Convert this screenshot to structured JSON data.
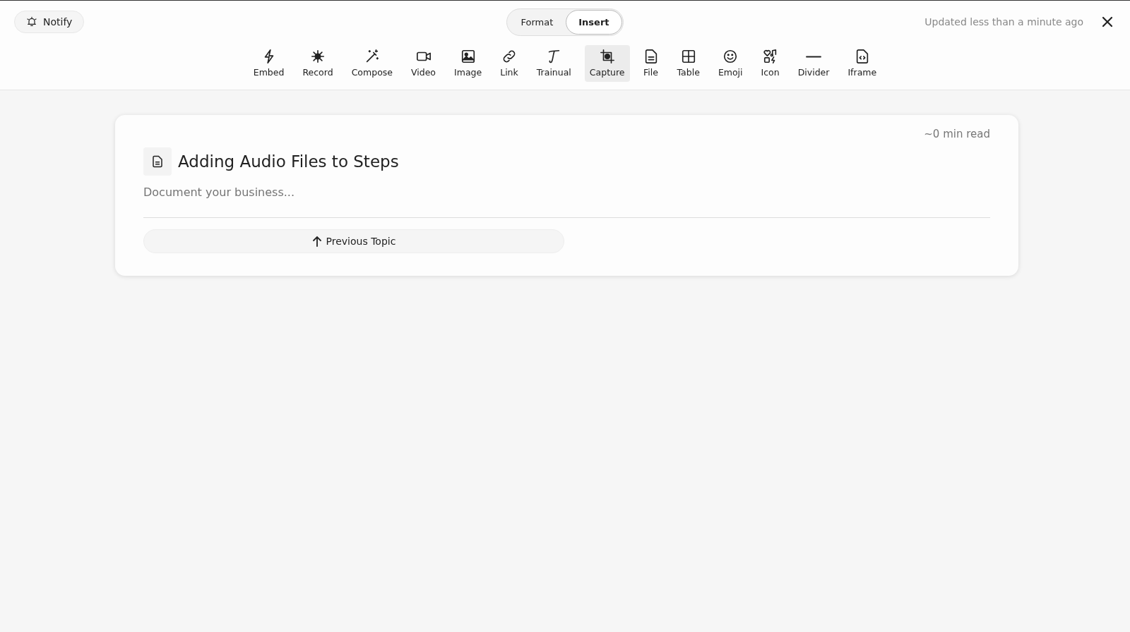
{
  "notify_button": {
    "label": "Notify"
  },
  "mode_switch": [
    {
      "label": "Format",
      "selected": false
    },
    {
      "label": "Insert",
      "selected": true
    }
  ],
  "status": "Updated less than a minute ago",
  "toolbar": [
    {
      "kind": "embed",
      "label": "Embed",
      "selected": false
    },
    {
      "kind": "record",
      "label": "Record",
      "selected": false
    },
    {
      "kind": "compose",
      "label": "Compose",
      "selected": false
    },
    {
      "kind": "video",
      "label": "Video",
      "selected": false
    },
    {
      "kind": "image",
      "label": "Image",
      "selected": false
    },
    {
      "kind": "link",
      "label": "Link",
      "selected": false
    },
    {
      "kind": "trainual",
      "label": "Trainual",
      "selected": false
    },
    {
      "kind": "capture",
      "label": "Capture",
      "selected": true
    },
    {
      "kind": "file",
      "label": "File",
      "selected": false
    },
    {
      "kind": "table",
      "label": "Table",
      "selected": false
    },
    {
      "kind": "emoji",
      "label": "Emoji",
      "selected": false
    },
    {
      "kind": "icon",
      "label": "Icon",
      "selected": false
    },
    {
      "kind": "divider",
      "label": "Divider",
      "selected": false
    },
    {
      "kind": "iframe",
      "label": "Iframe",
      "selected": false
    }
  ],
  "document": {
    "read_time": "~0 min read",
    "title": "Adding Audio Files to Steps",
    "placeholder": "Document your business...",
    "previous_button": "Previous Topic"
  }
}
